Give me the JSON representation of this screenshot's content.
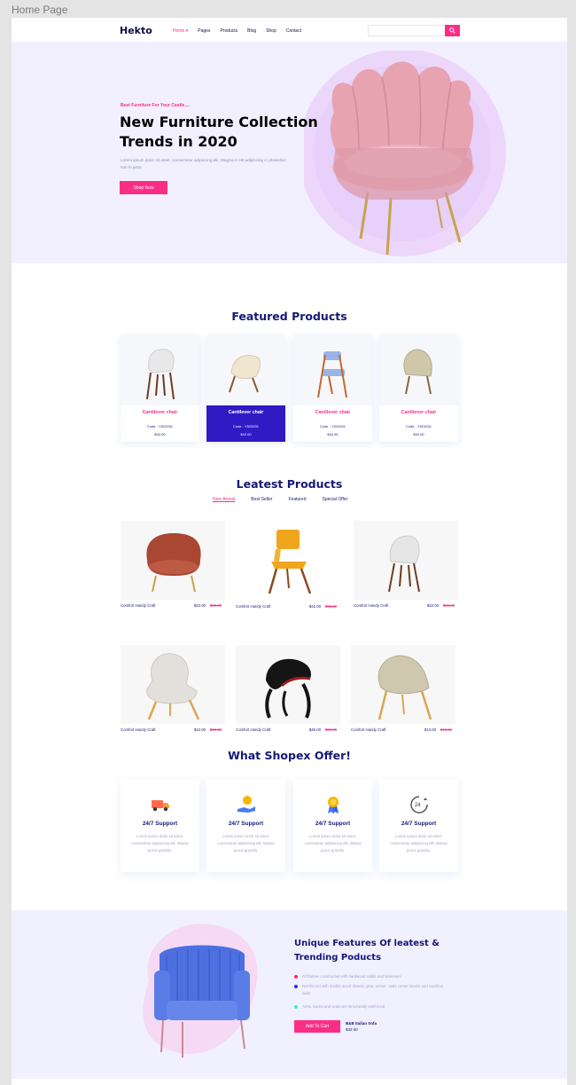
{
  "frame": {
    "title": "Home Page"
  },
  "header": {
    "logo": "Hekto",
    "nav": [
      {
        "label": "Home ▾",
        "active": true
      },
      {
        "label": "Pages",
        "active": false
      },
      {
        "label": "Products",
        "active": false
      },
      {
        "label": "Blog",
        "active": false
      },
      {
        "label": "Shop",
        "active": false
      },
      {
        "label": "Contact",
        "active": false
      }
    ],
    "search": {
      "placeholder": ""
    }
  },
  "hero": {
    "tagline": "Best Furniture For Your Castle....",
    "title": "New Furniture Collection Trends in 2020",
    "description": "Lorem ipsum dolor sit amet, consectetur adipiscing elit. Magna in est adipiscing in phasellus non in justo.",
    "cta": "Shop Now"
  },
  "featured": {
    "heading": "Featured Products",
    "items": [
      {
        "name": "Cantilever chair",
        "code": "Code - Y523201",
        "price": "$42.00"
      },
      {
        "name": "Cantilever chair",
        "code": "Code - Y523201",
        "price": "$42.00"
      },
      {
        "name": "Cantilever chair",
        "code": "Code - Y523201",
        "price": "$42.00"
      },
      {
        "name": "Cantilever chair",
        "code": "Code - Y523201",
        "price": "$42.00"
      }
    ]
  },
  "latest": {
    "heading": "Leatest Products",
    "tabs": [
      {
        "label": "New Arrival",
        "active": true
      },
      {
        "label": "Best Seller",
        "active": false
      },
      {
        "label": "Featured",
        "active": false
      },
      {
        "label": "Special Offer",
        "active": false
      }
    ],
    "items": [
      {
        "name": "Comfort Handy Craft",
        "price": "$42.00",
        "old_price": "$65.00"
      },
      {
        "name": "Comfort Handy Craft",
        "price": "$42.00",
        "old_price": "$65.00"
      },
      {
        "name": "Comfort Handy Craft",
        "price": "$42.00",
        "old_price": "$65.00"
      },
      {
        "name": "Comfort Handy Craft",
        "price": "$42.00",
        "old_price": "$65.00"
      },
      {
        "name": "Comfort Handy Craft",
        "price": "$45.00",
        "old_price": "$65.00"
      },
      {
        "name": "Comfort Handy Craft",
        "price": "$13.00",
        "old_price": "$40.00"
      }
    ]
  },
  "offer": {
    "heading": "What Shopex Offer!",
    "items": [
      {
        "title": "24/7 Support",
        "text": "Lorem ipsum dolor sit amet, consectetur adipiscing elit. Massa purus gravida."
      },
      {
        "title": "24/7 Support",
        "text": "Lorem ipsum dolor sit amet, consectetur adipiscing elit. Massa purus gravida."
      },
      {
        "title": "24/7 Support",
        "text": "Lorem ipsum dolor sit amet, consectetur adipiscing elit. Massa purus gravida."
      },
      {
        "title": "24/7 Support",
        "text": "Lorem ipsum dolor sit amet, consectetur adipiscing elit. Massa purus gravida."
      }
    ]
  },
  "unique": {
    "title": "Unique Features Of leatest & Trending Poducts",
    "features": [
      "All frames constructed with hardwood solids and laminates",
      "Reinforced with double wood dowels, glue, screw - nails corner blocks and machine nails",
      "Arms, backs and seats are structurally reinforced"
    ],
    "cta": "Add To Cart",
    "product_name": "B&B Italian Sofa",
    "product_price": "$32.00"
  },
  "colors": {
    "accent": "#fb2e86",
    "navy": "#151875",
    "selected": "#2f1ac4",
    "hero_bg": "#f2f0ff"
  }
}
